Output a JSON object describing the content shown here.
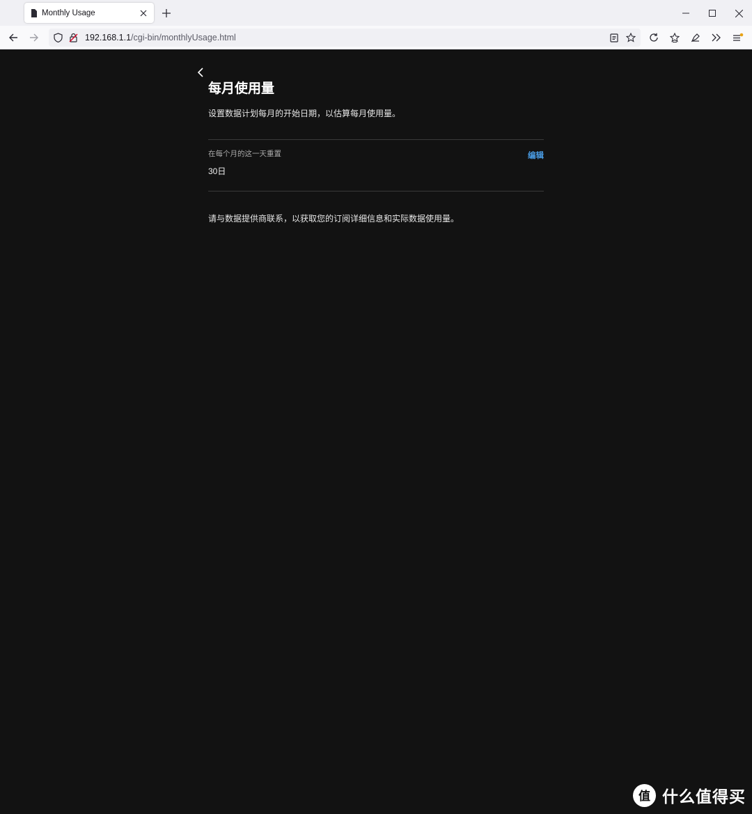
{
  "browser": {
    "tab": {
      "title": "Monthly Usage",
      "favicon": "page-icon"
    },
    "url": {
      "host": "192.168.1.1",
      "path": "/cgi-bin/monthlyUsage.html"
    },
    "icons": [
      "back-arrow-icon",
      "forward-arrow-icon",
      "shield-icon",
      "insecure-lock-icon",
      "reader-view-icon",
      "bookmark-star-icon",
      "reload-icon",
      "bookmarks-icon",
      "extensions-icon",
      "overflow-icon",
      "menu-icon"
    ]
  },
  "page": {
    "title": "每月使用量",
    "description": "设置数据计划每月的开始日期，以估算每月使用量。",
    "setting": {
      "label": "在每个月的这一天重置",
      "value": "30日",
      "edit_label": "编辑"
    },
    "footer_note": "请与数据提供商联系，以获取您的订阅详细信息和实际数据使用量。"
  },
  "watermark": {
    "text": "什么值得买",
    "logo_text": "值"
  },
  "colors": {
    "page_bg": "#121212",
    "accent": "#4a9de6",
    "chrome_bg": "#f0f0f4"
  }
}
